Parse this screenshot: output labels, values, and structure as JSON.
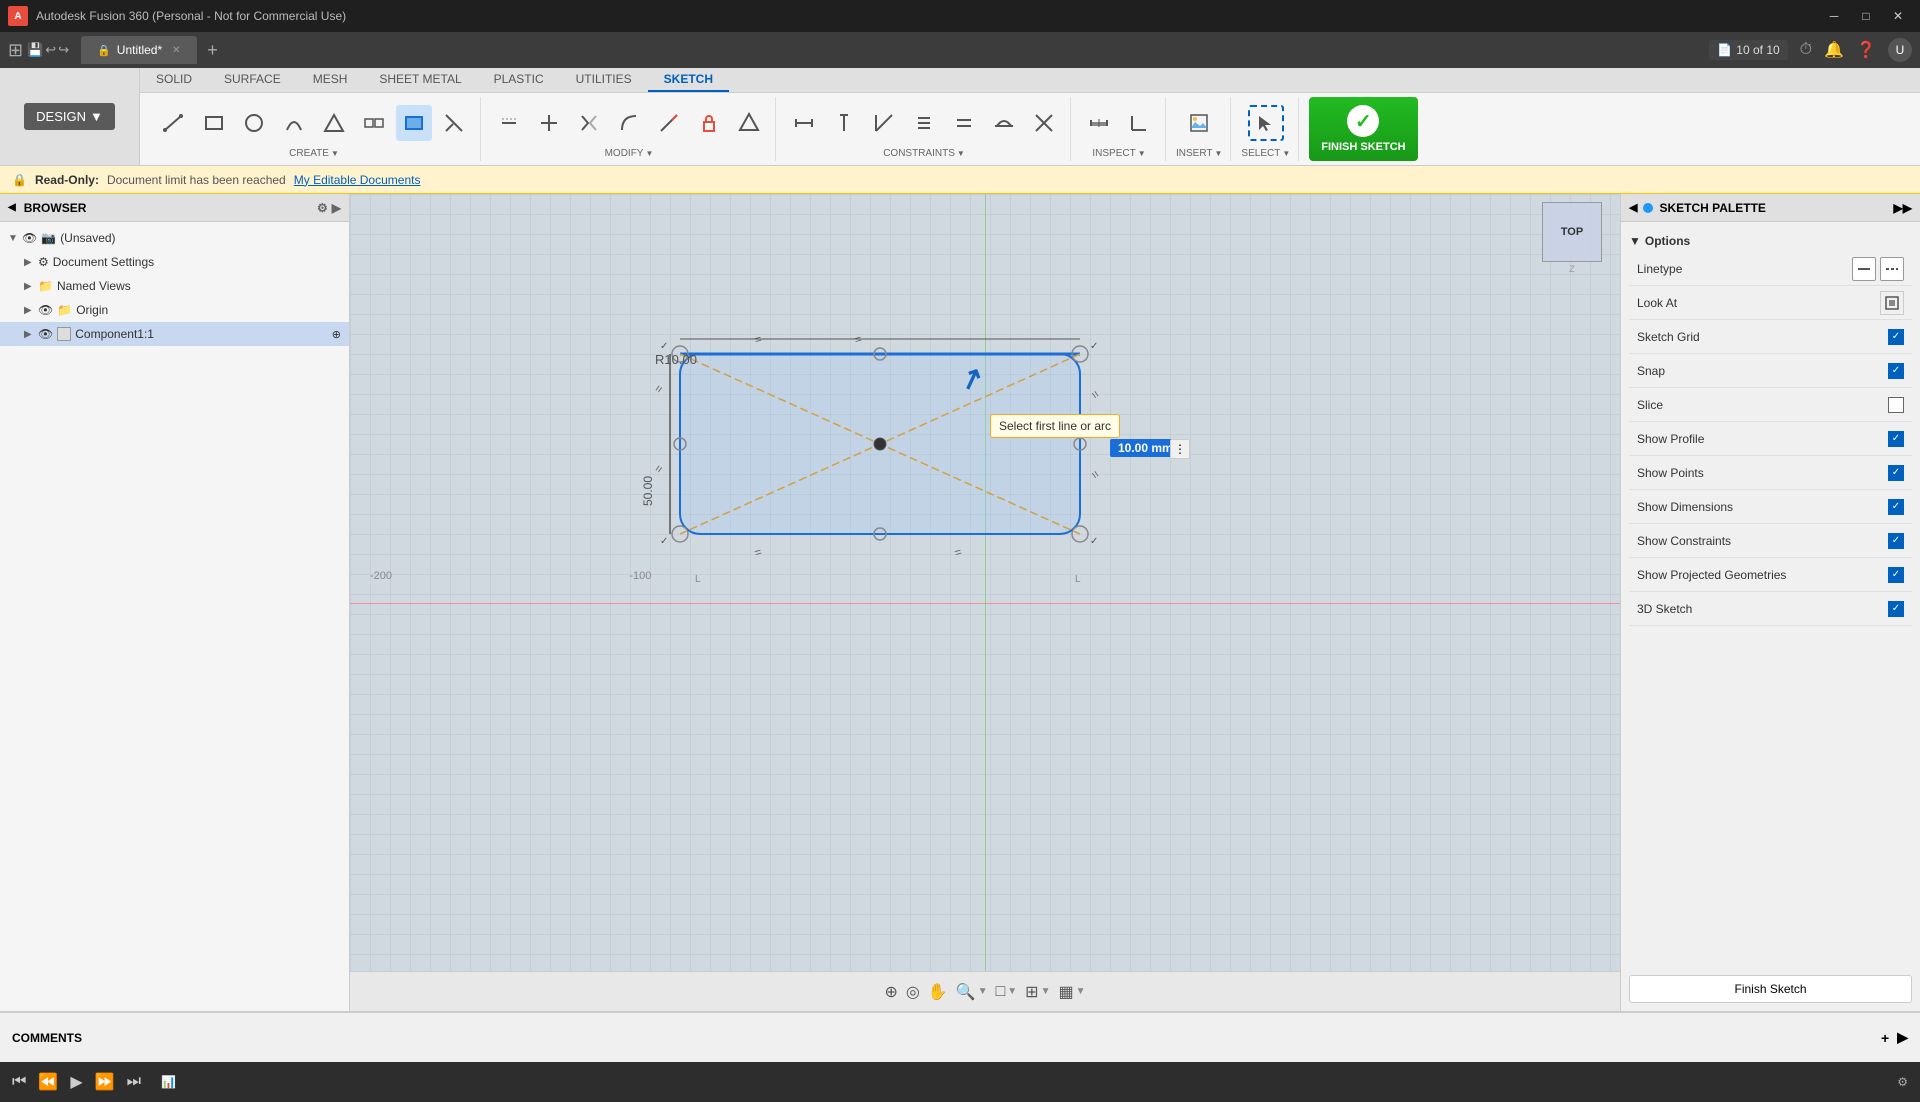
{
  "app": {
    "title": "Autodesk Fusion 360 (Personal - Not for Commercial Use)",
    "icon": "A"
  },
  "window_controls": {
    "minimize": "─",
    "maximize": "□",
    "close": "✕"
  },
  "tab": {
    "name": "Untitled*",
    "close": "✕"
  },
  "counter": {
    "label": "10 of 10"
  },
  "ribbon_tabs": [
    {
      "id": "solid",
      "label": "SOLID"
    },
    {
      "id": "surface",
      "label": "SURFACE"
    },
    {
      "id": "mesh",
      "label": "MESH"
    },
    {
      "id": "sheet-metal",
      "label": "SHEET METAL"
    },
    {
      "id": "plastic",
      "label": "PLASTIC"
    },
    {
      "id": "utilities",
      "label": "UTILITIES"
    },
    {
      "id": "sketch",
      "label": "SKETCH",
      "active": true
    }
  ],
  "ribbon_groups": {
    "create": {
      "label": "CREATE"
    },
    "modify": {
      "label": "MODIFY"
    },
    "constraints": {
      "label": "CONSTRAINTS"
    },
    "inspect": {
      "label": "INSPECT"
    },
    "insert": {
      "label": "INSERT"
    },
    "select": {
      "label": "SELECT"
    },
    "finish_sketch": {
      "label": "FINISH SKETCH"
    }
  },
  "design_btn": {
    "label": "DESIGN",
    "arrow": "▼"
  },
  "readonly_bar": {
    "icon": "🔒",
    "label": "Read-Only:",
    "message": "Document limit has been reached",
    "link": "My Editable Documents"
  },
  "browser": {
    "title": "BROWSER",
    "items": [
      {
        "id": "unsaved",
        "label": "(Unsaved)",
        "indent": 0,
        "type": "root",
        "expanded": true
      },
      {
        "id": "doc-settings",
        "label": "Document Settings",
        "indent": 1,
        "type": "settings"
      },
      {
        "id": "named-views",
        "label": "Named Views",
        "indent": 1,
        "type": "views"
      },
      {
        "id": "origin",
        "label": "Origin",
        "indent": 1,
        "type": "origin"
      },
      {
        "id": "component1",
        "label": "Component1:1",
        "indent": 1,
        "type": "component",
        "selected": true
      }
    ]
  },
  "canvas": {
    "sketch": {
      "r_label": "R10.00",
      "dim_50": "50.00",
      "tooltip": "Select first line or arc",
      "dim_value": "10.00 mm"
    },
    "axis_labels": [
      "-200",
      "-100"
    ]
  },
  "view_cube": {
    "label": "TOP"
  },
  "sketch_palette": {
    "title": "SKETCH PALETTE",
    "section": "Options",
    "rows": [
      {
        "id": "linetype",
        "label": "Linetype",
        "type": "linetype"
      },
      {
        "id": "look-at",
        "label": "Look At",
        "type": "button"
      },
      {
        "id": "sketch-grid",
        "label": "Sketch Grid",
        "type": "checkbox",
        "checked": true
      },
      {
        "id": "snap",
        "label": "Snap",
        "type": "checkbox",
        "checked": true
      },
      {
        "id": "slice",
        "label": "Slice",
        "type": "checkbox",
        "checked": false
      },
      {
        "id": "show-profile",
        "label": "Show Profile",
        "type": "checkbox",
        "checked": true
      },
      {
        "id": "show-points",
        "label": "Show Points",
        "type": "checkbox",
        "checked": true
      },
      {
        "id": "show-dimensions",
        "label": "Show Dimensions",
        "type": "checkbox",
        "checked": true
      },
      {
        "id": "show-constraints",
        "label": "Show Constraints",
        "type": "checkbox",
        "checked": true
      },
      {
        "id": "show-projected",
        "label": "Show Projected Geometries",
        "type": "checkbox",
        "checked": true
      },
      {
        "id": "3d-sketch",
        "label": "3D Sketch",
        "type": "checkbox",
        "checked": true
      }
    ],
    "finish_btn": "Finish Sketch"
  },
  "bottom_toolbar": {
    "icons": [
      "⊕",
      "◎",
      "✋",
      "⊕",
      "🔍",
      "□",
      "⊞",
      "▦"
    ]
  },
  "comments": {
    "label": "COMMENTS"
  },
  "playback": {
    "first": "⏮",
    "prev": "⏪",
    "play": "▶",
    "next": "⏩",
    "last": "⏭"
  },
  "finish_sketch_btn": "Finish Sketch"
}
